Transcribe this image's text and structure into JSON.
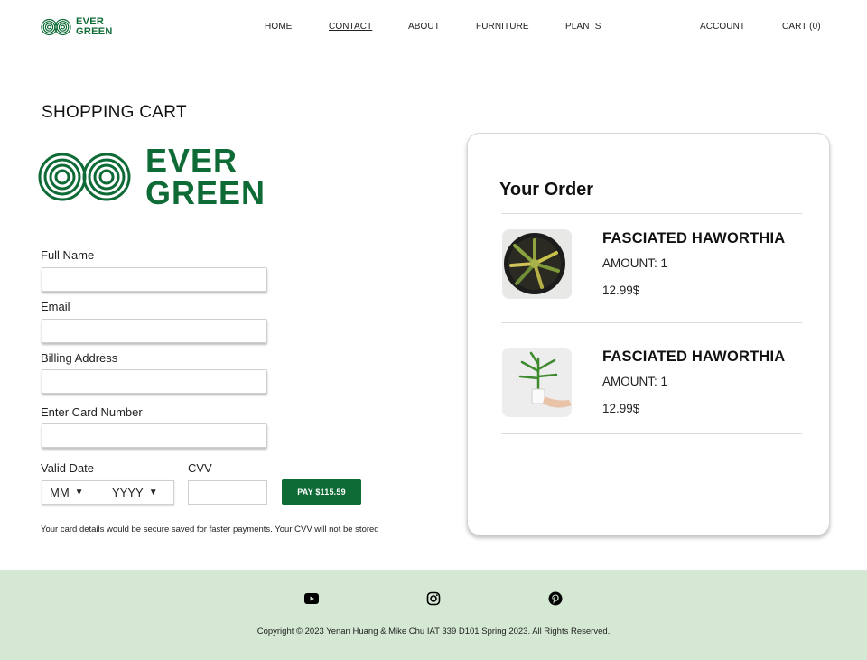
{
  "nav": {
    "logo_line1": "EVER",
    "logo_line2": "GREEN",
    "links": {
      "home": "HOME",
      "contact": "CONTACT",
      "about": "ABOUT",
      "furniture": "FURNITURE",
      "plants": "PLANTS",
      "account": "ACCOUNT",
      "cart": "CART (0)"
    }
  },
  "page": {
    "title": "SHOPPING CART"
  },
  "brand": {
    "line1": "EVER",
    "line2": "GREEN",
    "color": "#0e6b36"
  },
  "form": {
    "full_name_label": "Full Name",
    "full_name_value": "",
    "email_label": "Email",
    "email_value": "",
    "billing_label": "Billing Address",
    "billing_value": "",
    "card_label": "Enter Card Number",
    "card_value": "",
    "valid_date_label": "Valid Date",
    "month_selected": "MM",
    "year_selected": "YYYY",
    "cvv_label": "CVV",
    "cvv_value": "",
    "pay_label": "PAY $115.59",
    "note": "Your card details would be secure saved for faster payments. Your CVV will not be stored"
  },
  "order": {
    "title": "Your Order",
    "items": [
      {
        "name": "FASCIATED HAWORTHIA",
        "amount": "AMOUNT: 1",
        "price": "12.99$",
        "image_icon": "succulent-photo"
      },
      {
        "name": "FASCIATED HAWORTHIA",
        "amount": "AMOUNT: 1",
        "price": "12.99$",
        "image_icon": "potted-plant-photo"
      }
    ]
  },
  "footer": {
    "background": "#d4e8d4",
    "icons": [
      "youtube-icon",
      "instagram-icon",
      "pinterest-icon"
    ],
    "copyright": "Copyright © 2023 Yenan Huang & Mike Chu IAT 339 D101 Spring 2023. All Rights Reserved."
  }
}
